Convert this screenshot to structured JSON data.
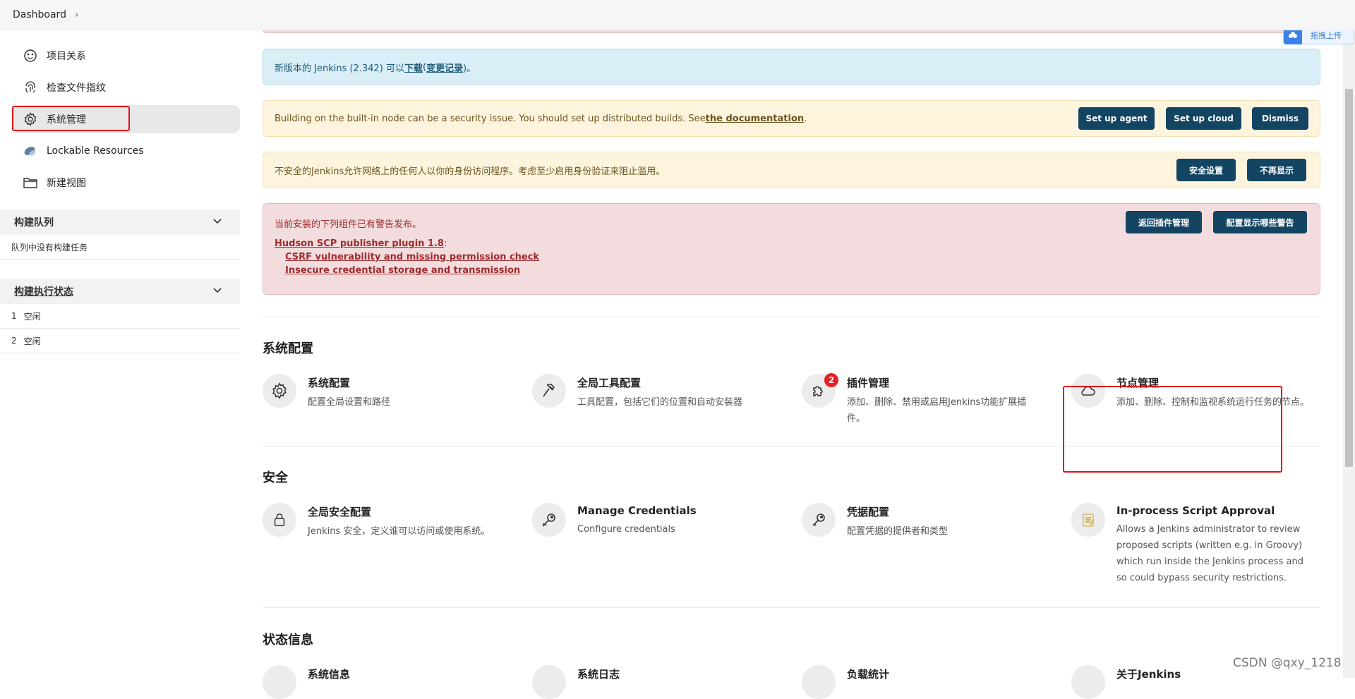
{
  "breadcrumb": {
    "root": "Dashboard"
  },
  "sidebar": {
    "items": [
      {
        "label": "项目关系",
        "icon": "relationship-icon"
      },
      {
        "label": "检查文件指纹",
        "icon": "fingerprint-icon"
      },
      {
        "label": "系统管理",
        "icon": "gear-icon",
        "active": true
      },
      {
        "label": "Lockable Resources",
        "icon": "resource-icon"
      },
      {
        "label": "新建视图",
        "icon": "folder-icon"
      }
    ],
    "build_queue": {
      "title": "构建队列",
      "empty": "队列中没有构建任务"
    },
    "executor_status": {
      "title": "构建执行状态",
      "executors": [
        {
          "num": "1",
          "status": "空闲"
        },
        {
          "num": "2",
          "status": "空闲"
        }
      ]
    }
  },
  "alerts": {
    "update": {
      "prefix": "新版本的 Jenkins (2.342) 可以",
      "download": "下载",
      "open": " (",
      "changelog": "变更记录",
      "close": ")。"
    },
    "builtin": {
      "text": "Building on the built-in node can be a security issue. You should set up distributed builds. See ",
      "link": "the documentation",
      "suffix": ".",
      "btn_agent": "Set up agent",
      "btn_cloud": "Set up cloud",
      "btn_dismiss": "Dismiss"
    },
    "insecure": {
      "text": "不安全的Jenkins允许网络上的任何人以你的身份访问程序。考虑至少启用身份验证来阻止滥用。",
      "btn_security": "安全设置",
      "btn_hide": "不再显示"
    },
    "plugin_warning": {
      "text": "当前安装的下列组件已有警告发布。",
      "plugin": "Hudson SCP publisher plugin 1.8",
      "plugin_colon": ":",
      "issues": [
        "CSRF vulnerability and missing permission check",
        "Insecure credential storage and transmission"
      ],
      "btn_back": "返回插件管理",
      "btn_config": "配置显示哪些警告"
    }
  },
  "sections": {
    "system_config": {
      "title": "系统配置",
      "cards": [
        {
          "title": "系统配置",
          "desc": "配置全局设置和路径",
          "icon": "gear-icon"
        },
        {
          "title": "全局工具配置",
          "desc": "工具配置，包括它们的位置和自动安装器",
          "icon": "hammer-icon"
        },
        {
          "title": "插件管理",
          "desc": "添加、删除、禁用或启用Jenkins功能扩展插件。",
          "icon": "puzzle-icon",
          "badge": "2"
        },
        {
          "title": "节点管理",
          "desc": "添加、删除、控制和监视系统运行任务的节点。",
          "icon": "cloud-icon"
        }
      ]
    },
    "security": {
      "title": "安全",
      "cards": [
        {
          "title": "全局安全配置",
          "desc": "Jenkins 安全，定义谁可以访问或使用系统。",
          "icon": "lock-icon"
        },
        {
          "title": "Manage Credentials",
          "desc": "Configure credentials",
          "icon": "key-icon"
        },
        {
          "title": "凭据配置",
          "desc": "配置凭据的提供者和类型",
          "icon": "key-icon"
        },
        {
          "title": "In-process Script Approval",
          "desc": "Allows a Jenkins administrator to review proposed scripts (written e.g. in Groovy) which run inside the Jenkins process and so could bypass security restrictions.",
          "icon": "notepad-icon"
        }
      ]
    },
    "status": {
      "title": "状态信息",
      "cards": [
        {
          "title": "系统信息",
          "icon": "monitor-icon"
        },
        {
          "title": "系统日志",
          "icon": "log-icon"
        },
        {
          "title": "负载统计",
          "icon": "gauge-icon"
        },
        {
          "title": "关于Jenkins",
          "icon": "help-icon"
        }
      ]
    }
  },
  "upload_widget": {
    "label": "拖拽上传"
  },
  "watermark": "CSDN @qxy_1218",
  "colors": {
    "button": "#134562",
    "highlight_box": "#e1131a",
    "badge": "#e32228"
  }
}
